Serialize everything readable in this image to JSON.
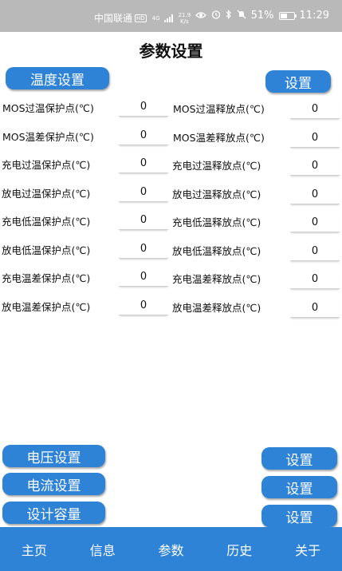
{
  "status_bar": {
    "carrier": "中国联通",
    "hd": "HD",
    "net": "4G",
    "speed_value": "21.9",
    "speed_unit": "K/s",
    "battery": "51%",
    "battery_level": 0.51,
    "time": "11:29",
    "icons": [
      "eye-icon",
      "alarm-icon",
      "bluetooth-icon",
      "mute-icon"
    ]
  },
  "page": {
    "title": "参数设置"
  },
  "temperature": {
    "section_button": "温度设置",
    "set_button": "设置",
    "left": [
      {
        "label": "MOS过温保护点(℃)",
        "value": "0"
      },
      {
        "label": "MOS温差保护点(℃)",
        "value": "0"
      },
      {
        "label": "充电过温保护点(℃)",
        "value": "0"
      },
      {
        "label": "放电过温保护点(℃)",
        "value": "0"
      },
      {
        "label": "充电低温保护点(℃)",
        "value": "0"
      },
      {
        "label": "放电低温保护点(℃)",
        "value": "0"
      },
      {
        "label": "充电温差保护点(℃)",
        "value": "0"
      },
      {
        "label": "放电温差保护点(℃)",
        "value": "0"
      }
    ],
    "right": [
      {
        "label": "MOS过温释放点(℃)",
        "value": "0"
      },
      {
        "label": "MOS温差释放点(℃)",
        "value": "0"
      },
      {
        "label": "充电过温释放点(℃)",
        "value": "0"
      },
      {
        "label": "放电过温释放点(℃)",
        "value": "0"
      },
      {
        "label": "充电低温释放点(℃)",
        "value": "0"
      },
      {
        "label": "放电低温释放点(℃)",
        "value": "0"
      },
      {
        "label": "充电温差释放点(℃)",
        "value": "0"
      },
      {
        "label": "放电温差释放点(℃)",
        "value": "0"
      }
    ]
  },
  "lower_sections": [
    {
      "section_button": "电压设置",
      "set_button": "设置"
    },
    {
      "section_button": "电流设置",
      "set_button": "设置"
    },
    {
      "section_button": "设计容量",
      "set_button": "设置"
    }
  ],
  "nav": [
    "主页",
    "信息",
    "参数",
    "历史",
    "关于"
  ],
  "colors": {
    "accent": "#2f83d6",
    "status_bar": "#b9b9b9"
  }
}
